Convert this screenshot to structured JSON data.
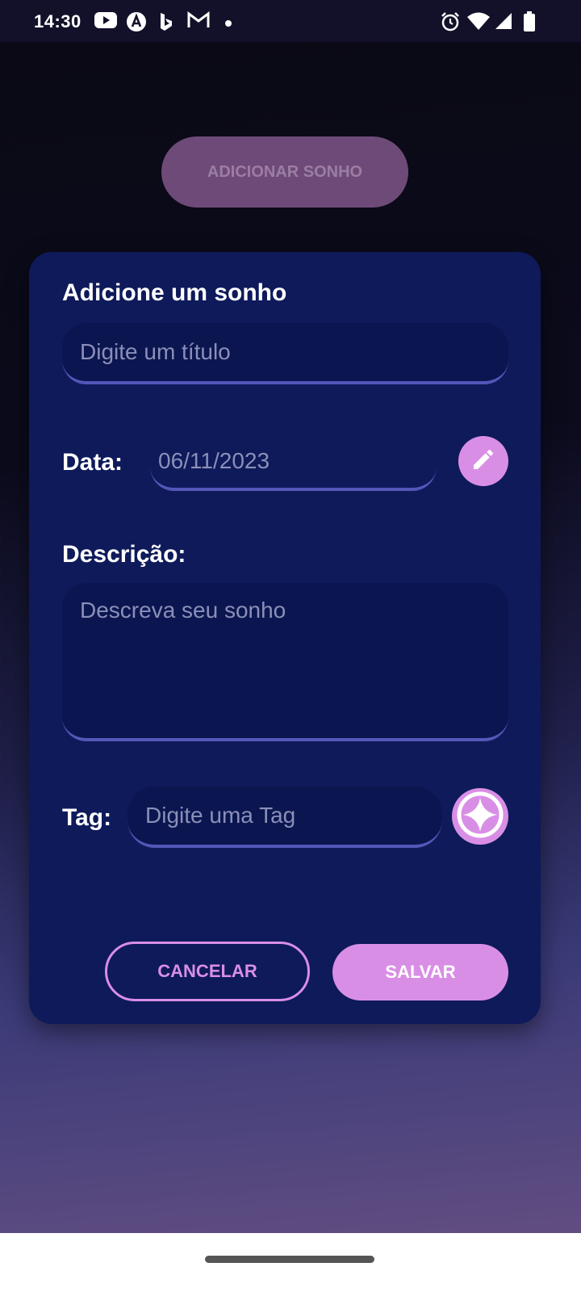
{
  "status_bar": {
    "time": "14:30",
    "left_icons": [
      "youtube-icon",
      "arc-icon",
      "bing-icon",
      "gmail-icon",
      "dot-icon"
    ],
    "right_icons": [
      "alarm-icon",
      "wifi-icon",
      "signal-icon",
      "battery-icon"
    ]
  },
  "background_button": {
    "label": "ADICIONAR SONHO"
  },
  "dialog": {
    "title": "Adicione um sonho",
    "title_field": {
      "placeholder": "Digite um título"
    },
    "date": {
      "label": "Data:",
      "value": "06/11/2023",
      "edit_icon": "pencil-icon"
    },
    "description": {
      "label": "Descrição:",
      "placeholder": "Descreva seu sonho"
    },
    "tag": {
      "label": "Tag:",
      "placeholder": "Digite uma Tag",
      "add_icon": "sparkle-icon"
    },
    "buttons": {
      "cancel": "CANCELAR",
      "save": "SALVAR"
    }
  },
  "colors": {
    "dialog_bg": "#0e1a5a",
    "accent": "#d98ee6",
    "field_underline": "#5457b8",
    "placeholder": "#8b8fb8"
  }
}
